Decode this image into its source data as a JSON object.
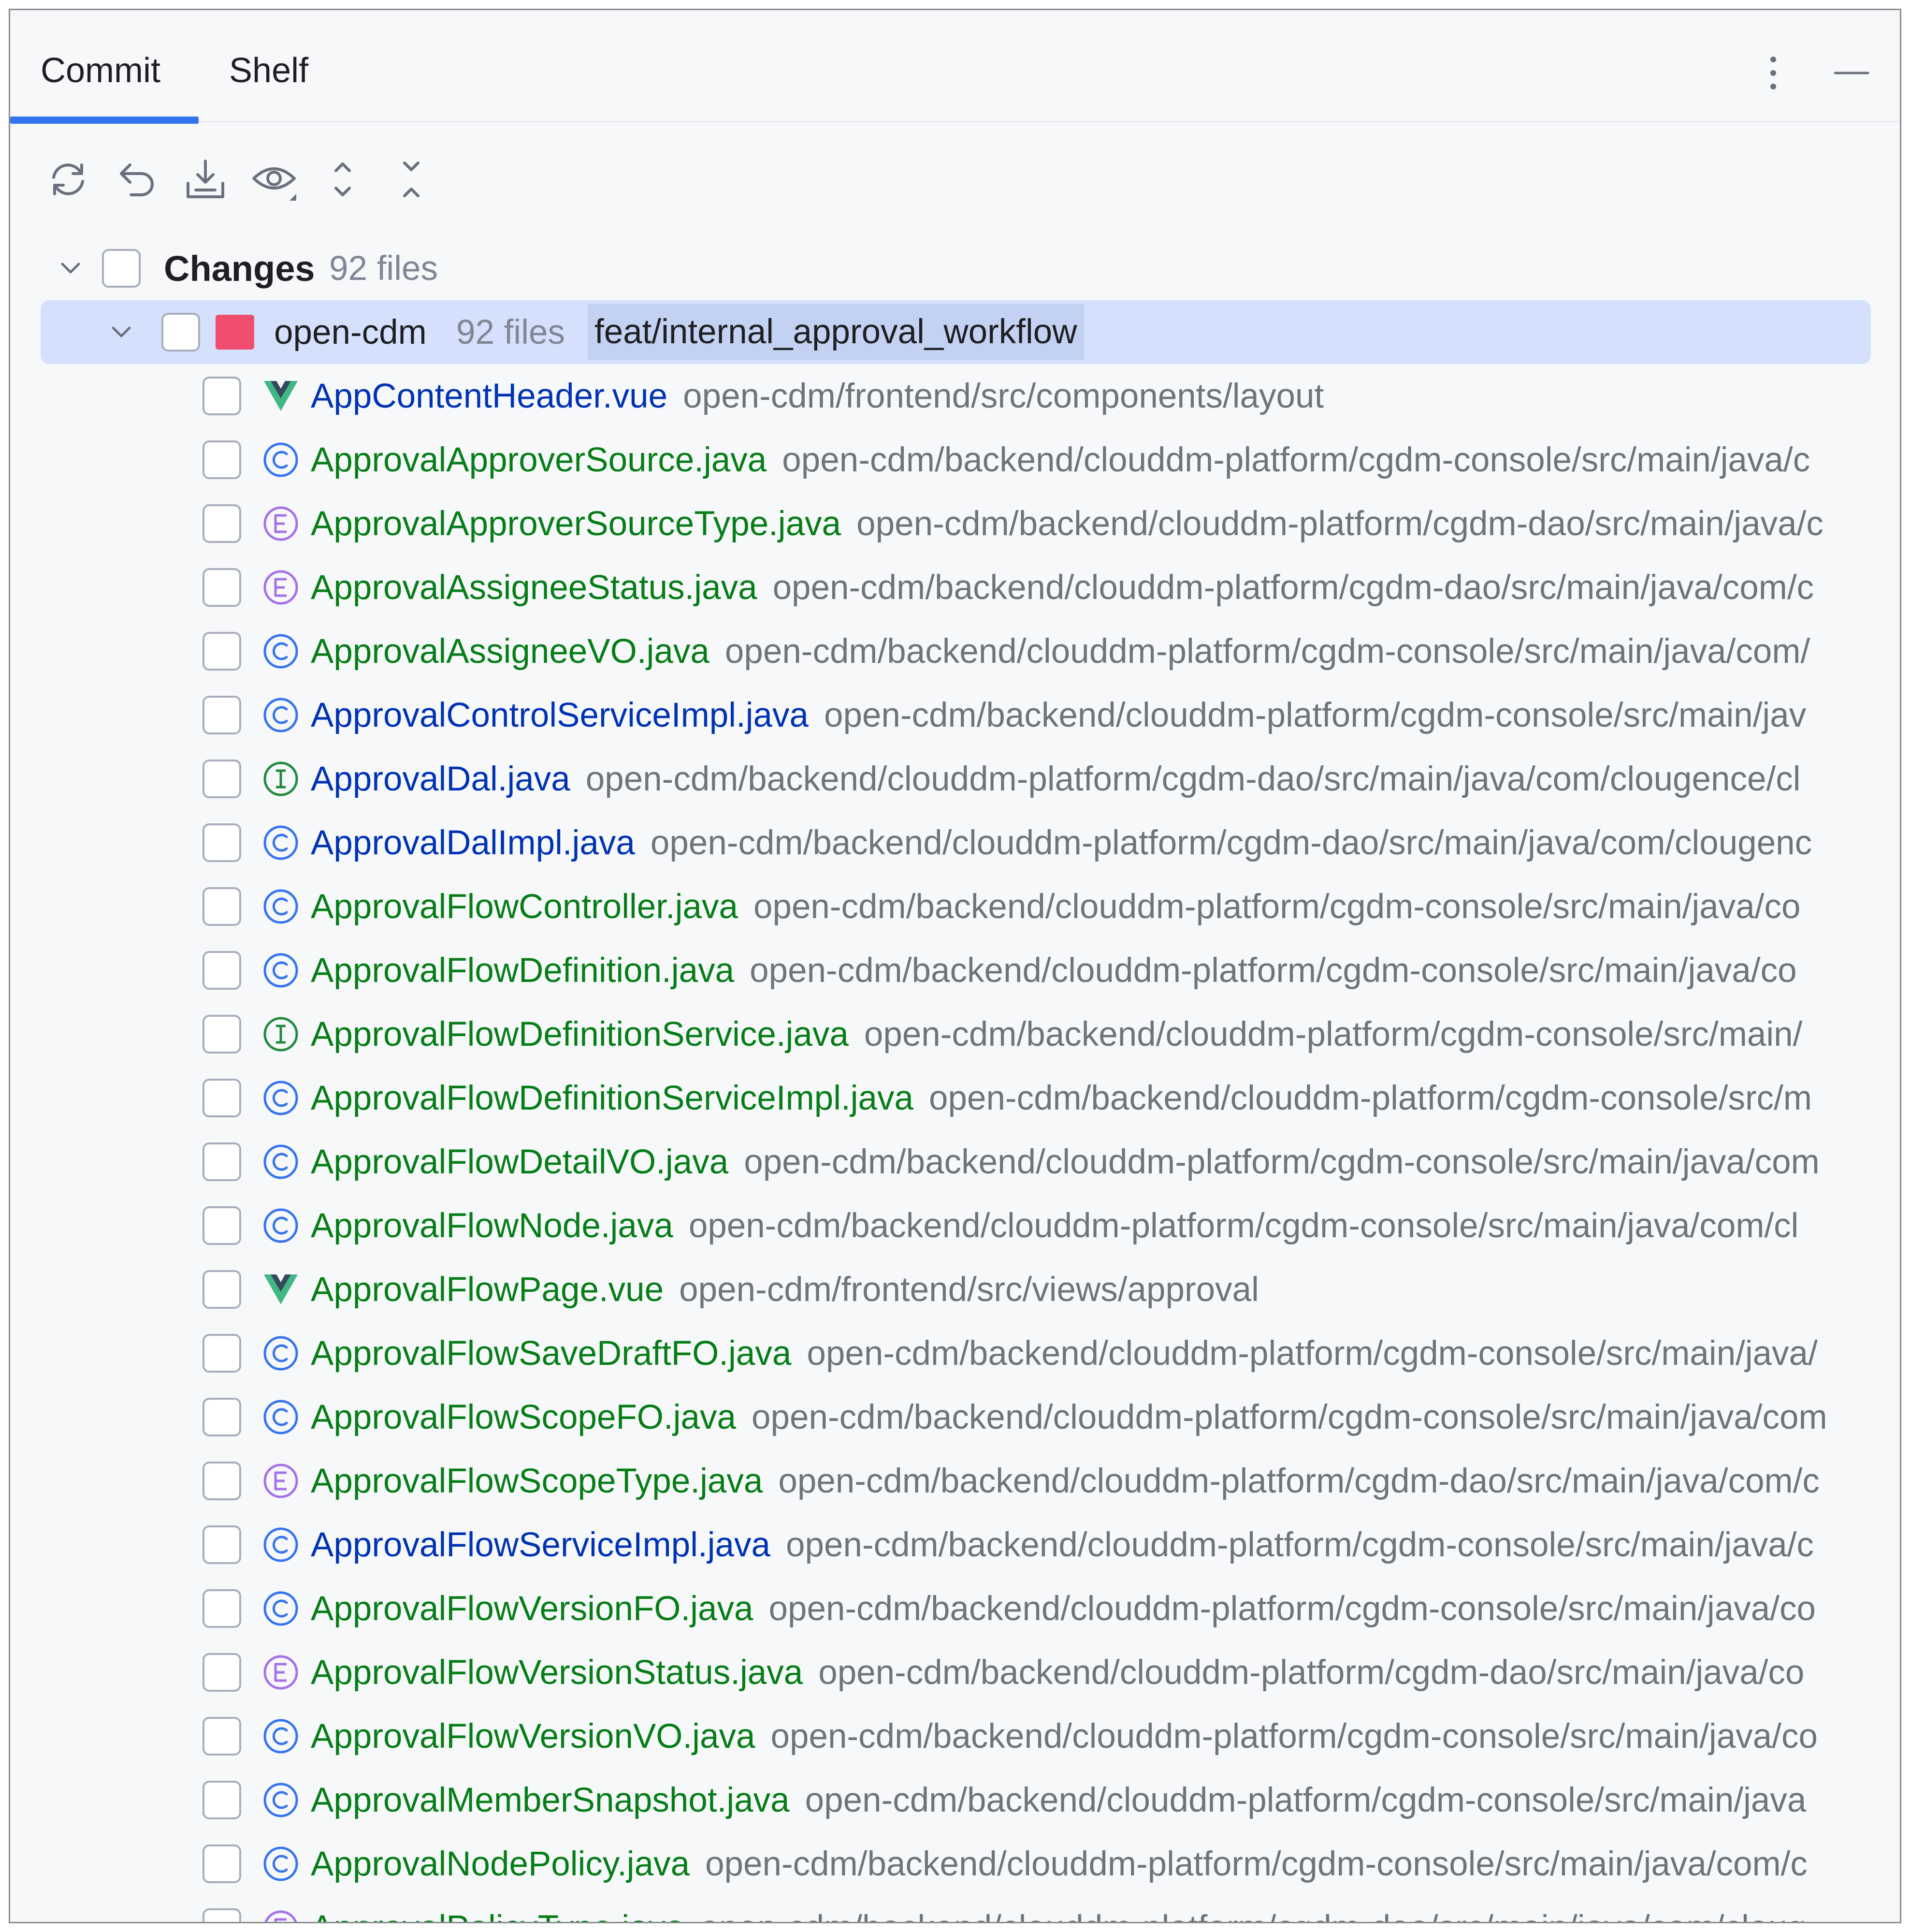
{
  "tabs": {
    "commit": "Commit",
    "shelf": "Shelf"
  },
  "header_icons": [
    "more-vertical-icon",
    "minimize-icon"
  ],
  "toolbar": {
    "buttons": [
      "refresh-icon",
      "rollback-icon",
      "shelve-icon",
      "preview-eye-icon",
      "expand-all-icon",
      "collapse-all-icon"
    ]
  },
  "changes": {
    "label": "Changes",
    "count": "92 files"
  },
  "repo": {
    "name": "open-cdm",
    "count": "92 files",
    "branch": "feat/internal_approval_workflow",
    "color": "#f04e6e"
  },
  "colors": {
    "accent": "#3574f0",
    "new_file": "#067d17",
    "modified_file": "#0033b3",
    "path": "#6f737a",
    "selection": "#d5e1fc"
  },
  "files": [
    {
      "name": "AppContentHeader.vue",
      "path": "open-cdm/frontend/src/components/layout",
      "icon": "vue",
      "status": "modified"
    },
    {
      "name": "ApprovalApproverSource.java",
      "path": "open-cdm/backend/clouddm-platform/cgdm-console/src/main/java/c",
      "icon": "class",
      "status": "new"
    },
    {
      "name": "ApprovalApproverSourceType.java",
      "path": "open-cdm/backend/clouddm-platform/cgdm-dao/src/main/java/c",
      "icon": "enum",
      "status": "new"
    },
    {
      "name": "ApprovalAssigneeStatus.java",
      "path": "open-cdm/backend/clouddm-platform/cgdm-dao/src/main/java/com/c",
      "icon": "enum",
      "status": "new"
    },
    {
      "name": "ApprovalAssigneeVO.java",
      "path": "open-cdm/backend/clouddm-platform/cgdm-console/src/main/java/com/",
      "icon": "class",
      "status": "new"
    },
    {
      "name": "ApprovalControlServiceImpl.java",
      "path": "open-cdm/backend/clouddm-platform/cgdm-console/src/main/jav",
      "icon": "class",
      "status": "modified"
    },
    {
      "name": "ApprovalDal.java",
      "path": "open-cdm/backend/clouddm-platform/cgdm-dao/src/main/java/com/clougence/cl",
      "icon": "interface",
      "status": "modified"
    },
    {
      "name": "ApprovalDalImpl.java",
      "path": "open-cdm/backend/clouddm-platform/cgdm-dao/src/main/java/com/clougenc",
      "icon": "class",
      "status": "modified"
    },
    {
      "name": "ApprovalFlowController.java",
      "path": "open-cdm/backend/clouddm-platform/cgdm-console/src/main/java/co",
      "icon": "class",
      "status": "new"
    },
    {
      "name": "ApprovalFlowDefinition.java",
      "path": "open-cdm/backend/clouddm-platform/cgdm-console/src/main/java/co",
      "icon": "class",
      "status": "new"
    },
    {
      "name": "ApprovalFlowDefinitionService.java",
      "path": "open-cdm/backend/clouddm-platform/cgdm-console/src/main/",
      "icon": "interface",
      "status": "new"
    },
    {
      "name": "ApprovalFlowDefinitionServiceImpl.java",
      "path": "open-cdm/backend/clouddm-platform/cgdm-console/src/m",
      "icon": "class",
      "status": "new"
    },
    {
      "name": "ApprovalFlowDetailVO.java",
      "path": "open-cdm/backend/clouddm-platform/cgdm-console/src/main/java/com",
      "icon": "class",
      "status": "new"
    },
    {
      "name": "ApprovalFlowNode.java",
      "path": "open-cdm/backend/clouddm-platform/cgdm-console/src/main/java/com/cl",
      "icon": "class",
      "status": "new"
    },
    {
      "name": "ApprovalFlowPage.vue",
      "path": "open-cdm/frontend/src/views/approval",
      "icon": "vue",
      "status": "new"
    },
    {
      "name": "ApprovalFlowSaveDraftFO.java",
      "path": "open-cdm/backend/clouddm-platform/cgdm-console/src/main/java/",
      "icon": "class",
      "status": "new"
    },
    {
      "name": "ApprovalFlowScopeFO.java",
      "path": "open-cdm/backend/clouddm-platform/cgdm-console/src/main/java/com",
      "icon": "class",
      "status": "new"
    },
    {
      "name": "ApprovalFlowScopeType.java",
      "path": "open-cdm/backend/clouddm-platform/cgdm-dao/src/main/java/com/c",
      "icon": "enum",
      "status": "new"
    },
    {
      "name": "ApprovalFlowServiceImpl.java",
      "path": "open-cdm/backend/clouddm-platform/cgdm-console/src/main/java/c",
      "icon": "class",
      "status": "modified"
    },
    {
      "name": "ApprovalFlowVersionFO.java",
      "path": "open-cdm/backend/clouddm-platform/cgdm-console/src/main/java/co",
      "icon": "class",
      "status": "new"
    },
    {
      "name": "ApprovalFlowVersionStatus.java",
      "path": "open-cdm/backend/clouddm-platform/cgdm-dao/src/main/java/co",
      "icon": "enum",
      "status": "new"
    },
    {
      "name": "ApprovalFlowVersionVO.java",
      "path": "open-cdm/backend/clouddm-platform/cgdm-console/src/main/java/co",
      "icon": "class",
      "status": "new"
    },
    {
      "name": "ApprovalMemberSnapshot.java",
      "path": "open-cdm/backend/clouddm-platform/cgdm-console/src/main/java",
      "icon": "class",
      "status": "new"
    },
    {
      "name": "ApprovalNodePolicy.java",
      "path": "open-cdm/backend/clouddm-platform/cgdm-console/src/main/java/com/c",
      "icon": "class",
      "status": "new"
    },
    {
      "name": "ApprovalPolicyType.java",
      "path": "open-cdm/backend/clouddm-platform/cgdm-dao/src/main/java/com/cloug",
      "icon": "enum",
      "status": "new"
    }
  ]
}
